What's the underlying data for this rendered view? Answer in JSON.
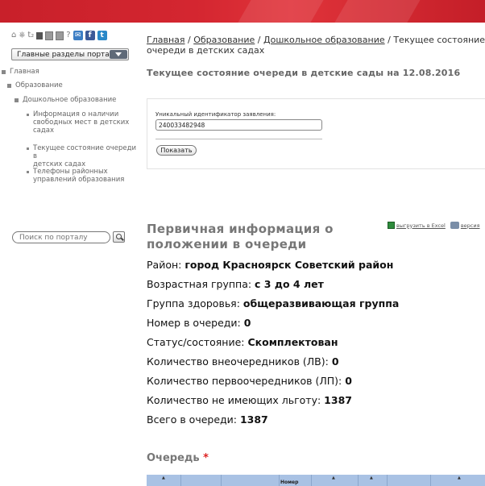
{
  "header_icons": [
    "home-icon",
    "sitemap-icon",
    "font-size-icon",
    "grid-icon",
    "page-icon",
    "help-icon",
    "mail-icon",
    "facebook-icon",
    "twitter-icon"
  ],
  "icon_glyphs": {
    "home": "⌂",
    "sitemap": "⎈",
    "font": "t₂",
    "help": "?",
    "mail": "✉",
    "facebook": "f",
    "twitter": "t"
  },
  "sections_select": {
    "value": "Главные разделы портала:"
  },
  "nav": {
    "items": [
      {
        "label": "Главная"
      },
      {
        "label": "Образование"
      },
      {
        "label": "Дошкольное образование"
      },
      {
        "label_lines": [
          "Информация о наличии",
          "свободных мест в детских",
          "садах"
        ]
      },
      {
        "label_lines": [
          "Текущее состояние очереди в",
          "детских садах"
        ]
      },
      {
        "label_lines": [
          "Телефоны районных",
          "управлений образования"
        ]
      }
    ]
  },
  "search": {
    "placeholder": "Поиск по порталу"
  },
  "breadcrumb": {
    "links": [
      "Главная",
      "Образование",
      "Дошкольное образование"
    ],
    "separator": " / ",
    "current_line1": "Текущее состояние",
    "current_line2": "очереди в детских садах"
  },
  "page_title": "Текущее состояние очереди в детские сады на 12.08.2016",
  "form": {
    "label": "Уникальный идентификатор заявления:",
    "value": "240033482948",
    "button": "Показать"
  },
  "export": {
    "excel": "выгрузить в Excel",
    "print": "версия"
  },
  "info_title": "Первичная информация о положении в очереди",
  "info_rows": [
    {
      "label": "Район: ",
      "value": "город Красноярск Советский район"
    },
    {
      "label": "Возрастная группа: ",
      "value": "с 3 до 4 лет"
    },
    {
      "label": "Группа здоровья: ",
      "value": "общеразвивающая группа"
    },
    {
      "label": "Номер в очереди: ",
      "value": "0"
    },
    {
      "label": "Статус/состояние: ",
      "value": "Скомплектован"
    },
    {
      "label": "Количество внеочередников (ЛВ): ",
      "value": "0"
    },
    {
      "label": "Количество первоочередников (ЛП): ",
      "value": "0"
    },
    {
      "label": "Количество не имеющих льготу: ",
      "value": "1387"
    },
    {
      "label": "Всего в очереди: ",
      "value": "1387"
    }
  ],
  "queue": {
    "title": "Очередь",
    "star": "*",
    "header_partial": "Номер",
    "sort_glyph": "▲"
  },
  "colors": {
    "banner": "#d42630",
    "table_header": "#a9c2e4",
    "star": "#dd2222"
  }
}
